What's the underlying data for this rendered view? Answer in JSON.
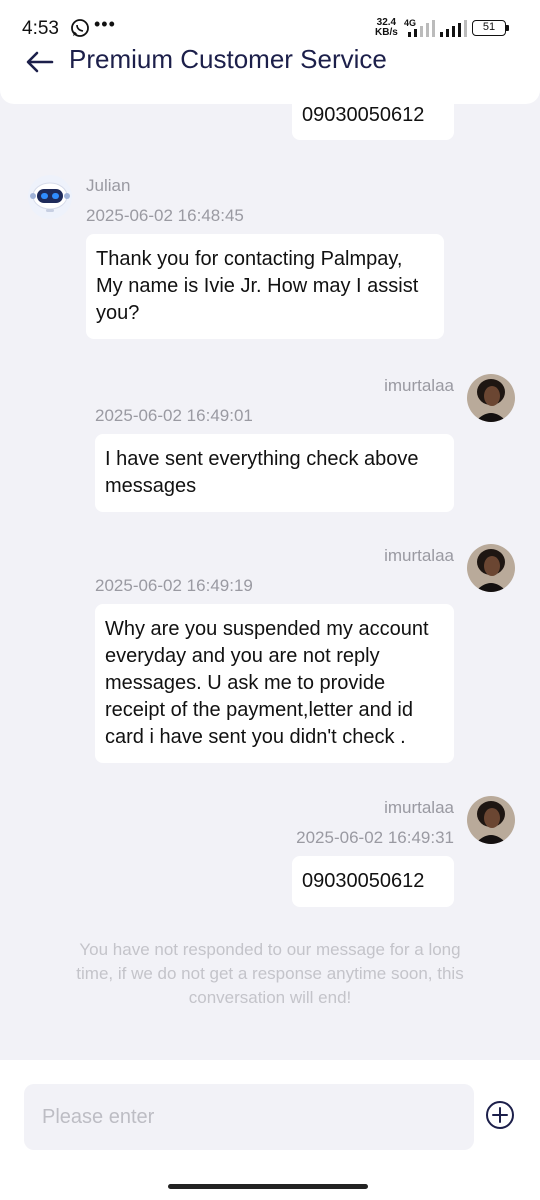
{
  "status_bar": {
    "time": "4:53",
    "dots": "•••",
    "net_speed_value": "32.4",
    "net_speed_unit": "KB/s",
    "net_type": "4G",
    "battery": "51",
    "icons": [
      "whatsapp-icon",
      "signal-icon",
      "battery-icon"
    ]
  },
  "header": {
    "title": "Premium Customer Service",
    "back_icon": "arrow-left-icon"
  },
  "messages": [
    {
      "from": "self",
      "text": "09030050612"
    },
    {
      "from": "agent",
      "sender": "Julian",
      "time": "2025-06-02 16:48:45",
      "text": "Thank you for contacting Palmpay, My name is Ivie Jr. How may I assist you?"
    },
    {
      "from": "self",
      "sender": "imurtalaa",
      "time": "2025-06-02 16:49:01",
      "text": "I have sent everything check above messages"
    },
    {
      "from": "self",
      "sender": "imurtalaa",
      "time": "2025-06-02 16:49:19",
      "text": "Why are you suspended my account everyday and you are not reply messages. U ask me to provide receipt of the payment,letter and id card i have sent you didn't check ."
    },
    {
      "from": "self",
      "sender": "imurtalaa",
      "time": "2025-06-02 16:49:31",
      "text": "09030050612"
    }
  ],
  "notice": "You have not responded to our message for a long time, if we do not get a response anytime soon, this conversation will end!",
  "footer": {
    "placeholder": "Please enter",
    "add_icon": "plus-circle-icon"
  },
  "colors": {
    "background": "#f2f2f7",
    "title": "#1c1f4a",
    "muted": "#9a9aa2",
    "bubble": "#ffffff"
  }
}
